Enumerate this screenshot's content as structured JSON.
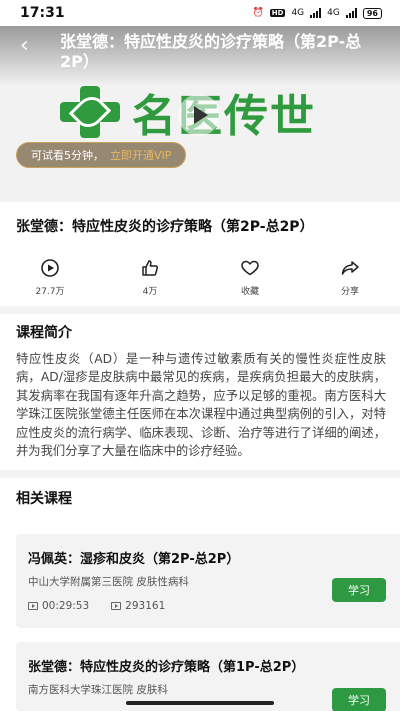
{
  "status_bar": {
    "time": "17:31",
    "hd_label": "HD",
    "net1": "4G",
    "net2": "4G",
    "battery": "96"
  },
  "video": {
    "overlay_title": "张堂德：特应性皮炎的诊疗策略（第2P-总2P）",
    "logo_text": "名医传世",
    "trial_text": "可试看5分钟，",
    "trial_link": "立即开通VIP"
  },
  "course": {
    "title": "张堂德：特应性皮炎的诊疗策略（第2P-总2P）"
  },
  "actions": [
    {
      "icon": "play-circle-icon",
      "label": "27.7万"
    },
    {
      "icon": "thumbs-up-icon",
      "label": "4万"
    },
    {
      "icon": "heart-icon",
      "label": "收藏"
    },
    {
      "icon": "share-icon",
      "label": "分享"
    }
  ],
  "intro": {
    "heading": "课程简介",
    "text": "特应性皮炎（AD）是一种与遗传过敏素质有关的慢性炎症性皮肤病，AD/湿疹是皮肤病中最常见的疾病，是疾病负担最大的皮肤病，其发病率在我国有逐年升高之趋势，应予以足够的重视。南方医科大学珠江医院张堂德主任医师在本次课程中通过典型病例的引入，对特应性皮炎的流行病学、临床表现、诊断、治疗等进行了详细的阐述，并为我们分享了大量在临床中的诊疗经验。"
  },
  "related": {
    "heading": "相关课程",
    "items": [
      {
        "title": "冯佩英：湿疹和皮炎（第2P-总2P）",
        "org": "中山大学附属第三医院 皮肤性病科",
        "duration": "00:29:53",
        "views": "293161",
        "button": "学习"
      },
      {
        "title": "张堂德：特应性皮炎的诊疗策略（第1P-总2P）",
        "org": "南方医科大学珠江医院 皮肤科",
        "button": "学习"
      }
    ]
  },
  "colors": {
    "brand_green": "#2d9a42",
    "vip_gold": "#e8b860"
  }
}
